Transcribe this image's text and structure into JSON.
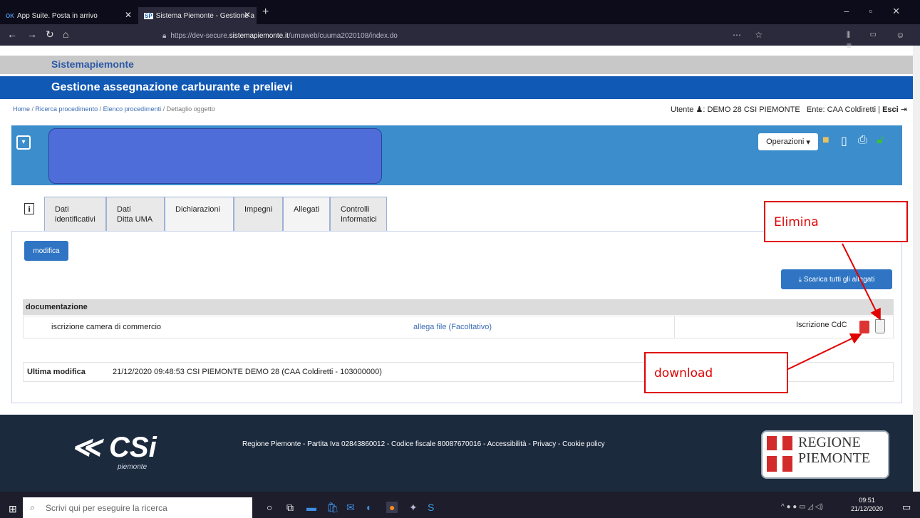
{
  "browser": {
    "tabs": [
      {
        "favicon": "OK",
        "label": "App Suite. Posta in arrivo"
      },
      {
        "favicon": "SP",
        "label": "Sistema Piemonte - Gestione a"
      }
    ],
    "url_prefix": "https://dev-secure.",
    "url_domain": "sistemapiemonte.it",
    "url_path": "/umaweb/cuuma2020108/index.do"
  },
  "header": {
    "brand": "Sistemapiemonte",
    "app_title": "Gestione assegnazione carburante e prelievi"
  },
  "breadcrumb": {
    "items": [
      "Home",
      "Ricerca procedimento",
      "Elenco procedimenti",
      "Dettaglio oggetto"
    ]
  },
  "user": {
    "label": "Utente",
    "name": "DEMO 28 CSI PIEMONTE",
    "ente_label": "Ente:",
    "ente": "CAA Coldiretti",
    "logout": "Esci"
  },
  "panel": {
    "operations_label": "Operazioni"
  },
  "tabs": [
    {
      "line1": "Dati",
      "line2": "identificativi"
    },
    {
      "line1": "Dati",
      "line2": "Ditta UMA"
    },
    {
      "line1": "Dichiarazioni",
      "line2": ""
    },
    {
      "line1": "Impegni",
      "line2": ""
    },
    {
      "line1": "Allegati",
      "line2": ""
    },
    {
      "line1": "Controlli",
      "line2": "Informatici"
    }
  ],
  "content": {
    "modifica_label": "modifica",
    "scarica_label": "Scarica tutti gli allegati",
    "section_title": "documentazione",
    "doc_row": {
      "name": "iscrizione camera di commercio",
      "link": "allega file (Facoltativo)",
      "file_label": "Iscrizione CdC"
    },
    "last_modified_label": "Ultima modifica",
    "last_modified_value": "21/12/2020 09:48:53 CSI PIEMONTE DEMO 28 (CAA Coldiretti - 103000000)"
  },
  "annotations": {
    "elimina": "Elimina",
    "download": "download",
    "color": "#e00000"
  },
  "footer": {
    "text": "Regione Piemonte - Partita Iva 02843860012 - Codice fiscale 80087670016 - Accessibilità - Privacy - Cookie policy",
    "csi_logo": "CSi",
    "csi_sub": "piemonte",
    "regione_line1": "REGIONE",
    "regione_line2": "PIEMONTE"
  },
  "taskbar": {
    "search_placeholder": "Scrivi qui per eseguire la ricerca",
    "time": "09:51",
    "date": "21/12/2020"
  }
}
